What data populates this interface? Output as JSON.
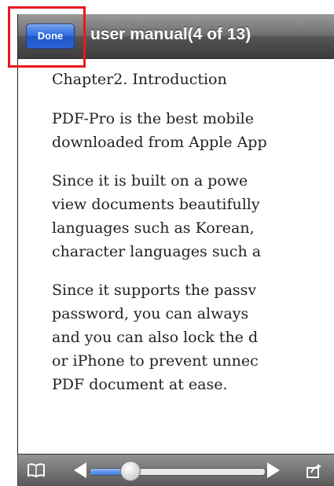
{
  "navbar": {
    "done_label": "Done",
    "title": "user manual(4 of 13)"
  },
  "document": {
    "chapter_title": "Chapter2. Introduction",
    "paragraph1": [
      "PDF-Pro is the best mobile",
      "downloaded from Apple App"
    ],
    "paragraph2": [
      "Since it is built on a powe",
      "view documents beautifully",
      "languages such as Korean,",
      "character languages such a"
    ],
    "paragraph3": [
      "Since it supports the passv",
      "password, you can always",
      "and you can also lock the d",
      "or iPhone to prevent unnec",
      "PDF document at ease."
    ]
  },
  "toolbar": {
    "icons": [
      "book-icon",
      "prev-page-icon",
      "next-page-icon",
      "share-icon"
    ],
    "page_slider": {
      "current_page": 4,
      "total_pages": 13,
      "fraction": 0.23
    }
  },
  "colors": {
    "highlight": "#e8191e",
    "done_button": "#2a63d6"
  }
}
